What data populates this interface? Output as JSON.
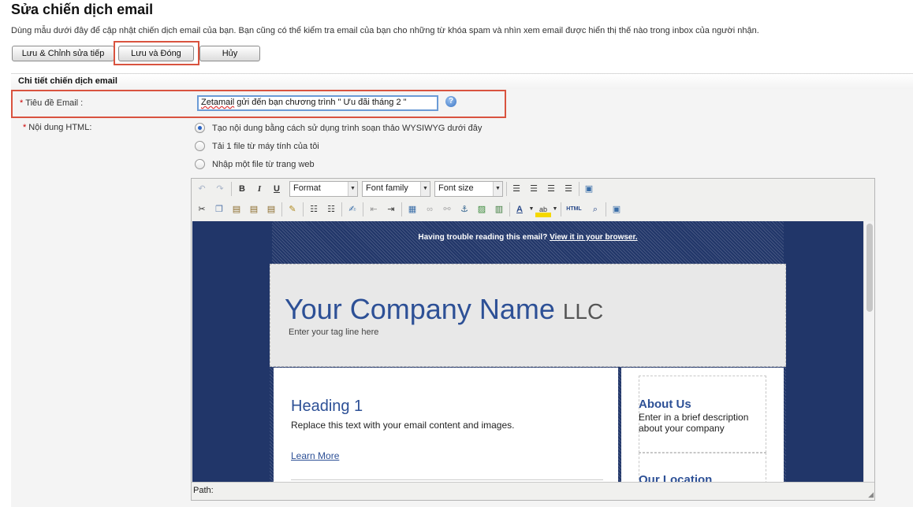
{
  "page": {
    "title": "Sửa chiến dịch email",
    "description": "Dùng mẫu dưới đây để cập nhật chiến dịch email của bạn. Bạn cũng có thể kiểm tra email của bạn cho những từ khóa spam và nhìn xem email được hiển thị thế nào trong inbox của người nhận."
  },
  "actions": {
    "save_continue": "Lưu & Chỉnh sửa tiếp",
    "save_close": "Lưu và Đóng",
    "cancel": "Hủy"
  },
  "section": {
    "title": "Chi tiết chiến dịch email"
  },
  "form": {
    "required_mark": "*",
    "subject_label": "Tiêu đề Email :",
    "subject_value_part1": "Zetamail",
    "subject_value_part2": " gửi đến bạn chương trình \" Ưu đãi tháng 2 \"",
    "html_label": "Nội dung HTML:",
    "options": [
      {
        "label": "Tạo nội dung bằng cách sử dụng trình soạn thảo WYSIWYG dưới đây",
        "selected": true
      },
      {
        "label": "Tải 1 file từ máy tính của tôi",
        "selected": false
      },
      {
        "label": "Nhập một file từ trang web",
        "selected": false
      }
    ]
  },
  "editor": {
    "format_select": "Format",
    "font_family_select": "Font family",
    "font_size_select": "Font size",
    "path_label": "Path:",
    "html_button": "HTML",
    "template": {
      "trouble_text": "Having trouble reading this email? ",
      "trouble_link": "View it in your browser.",
      "company_name": "Your Company Name",
      "company_suffix": "LLC",
      "tagline": "Enter your tag line here",
      "heading": "Heading 1",
      "body": "Replace this text with your email content and images.",
      "learn_more": "Learn More",
      "about_title": "About Us",
      "about_text": "Enter in a brief description about your company",
      "location_title": "Our Location"
    }
  },
  "colors": {
    "highlight": "#d9533f",
    "template_bg": "#213669",
    "template_heading": "#2d5096"
  }
}
